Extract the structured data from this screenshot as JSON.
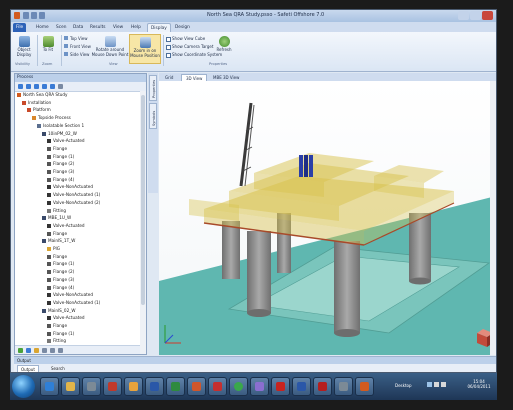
{
  "window": {
    "title": "North Sea QRA Study.psso - Safeti Offshore 7.0"
  },
  "ribbon_tabs": [
    "File",
    "Home",
    "Scen",
    "Data",
    "Results",
    "View",
    "Help",
    "Display",
    "Design"
  ],
  "ribbon": {
    "buttons": {
      "object_display": "Object Display",
      "to_fit": "To Fit",
      "top_view": "Top View",
      "front_view": "Front View",
      "side_view": "Side View",
      "rotate": "Rotate around Mouse Down Point",
      "zoom": "Zoom in on Mouse Position",
      "refresh": "Refresh"
    },
    "checkboxes": [
      "Show View Cube",
      "Show Camera Target",
      "Show Coordinate System"
    ],
    "groups": {
      "visibility": "Visibility",
      "zoom": "Zoom",
      "view": "View",
      "properties": "Properties"
    }
  },
  "process_panel": {
    "title": "Process",
    "tree": [
      {
        "label": "North Sea QRA Study",
        "indent": 0,
        "icon": "study"
      },
      {
        "label": "Installation",
        "indent": 1,
        "icon": "installation"
      },
      {
        "label": "Platform",
        "indent": 2,
        "icon": "platform"
      },
      {
        "label": "Topside Process",
        "indent": 3,
        "icon": "process"
      },
      {
        "label": "Isolatable Section 1",
        "indent": 4,
        "icon": "section"
      },
      {
        "label": "10inPM_02_W",
        "indent": 5,
        "icon": "pipe"
      },
      {
        "label": "Valve-Actuated",
        "indent": 6,
        "icon": "valve"
      },
      {
        "label": "Flange",
        "indent": 6,
        "icon": "flange"
      },
      {
        "label": "Flange (1)",
        "indent": 6,
        "icon": "flange"
      },
      {
        "label": "Flange (2)",
        "indent": 6,
        "icon": "flange"
      },
      {
        "label": "Flange (3)",
        "indent": 6,
        "icon": "flange"
      },
      {
        "label": "Flange (4)",
        "indent": 6,
        "icon": "flange"
      },
      {
        "label": "Valve-NonActuated",
        "indent": 6,
        "icon": "valve"
      },
      {
        "label": "Valve-NonActuated (1)",
        "indent": 6,
        "icon": "valve"
      },
      {
        "label": "Valve-NonActuated (2)",
        "indent": 6,
        "icon": "valve"
      },
      {
        "label": "Fitting",
        "indent": 6,
        "icon": "fitting"
      },
      {
        "label": "MBE_1U_W",
        "indent": 5,
        "icon": "pipe"
      },
      {
        "label": "Valve-Actuated",
        "indent": 6,
        "icon": "valve"
      },
      {
        "label": "Flange",
        "indent": 6,
        "icon": "flange"
      },
      {
        "label": "MainlS_1T_W",
        "indent": 5,
        "icon": "pipe"
      },
      {
        "label": "PIG",
        "indent": 6,
        "icon": "pig"
      },
      {
        "label": "Flange",
        "indent": 6,
        "icon": "flange"
      },
      {
        "label": "Flange (1)",
        "indent": 6,
        "icon": "flange"
      },
      {
        "label": "Flange (2)",
        "indent": 6,
        "icon": "flange"
      },
      {
        "label": "Flange (3)",
        "indent": 6,
        "icon": "flange"
      },
      {
        "label": "Flange (4)",
        "indent": 6,
        "icon": "flange"
      },
      {
        "label": "Valve-NonActuated",
        "indent": 6,
        "icon": "valve"
      },
      {
        "label": "Valve-NonActuated (1)",
        "indent": 6,
        "icon": "valve"
      },
      {
        "label": "MainlS_02_W",
        "indent": 5,
        "icon": "pipe"
      },
      {
        "label": "Valve-Actuated",
        "indent": 6,
        "icon": "valve"
      },
      {
        "label": "Flange",
        "indent": 6,
        "icon": "flange"
      },
      {
        "label": "Flange (1)",
        "indent": 6,
        "icon": "flange"
      },
      {
        "label": "Fitting",
        "indent": 6,
        "icon": "fitting"
      }
    ]
  },
  "side_tabs": [
    "Properties",
    "Symbols"
  ],
  "doc_tabs": [
    "Grid",
    "3D View",
    "MBE 3D View"
  ],
  "active_doc_tab": "3D View",
  "output_panel": {
    "title": "Output",
    "tabs": [
      "Output",
      "Search"
    ]
  },
  "taskbar": {
    "desktop_label": "Desktop",
    "time": "15:04",
    "date": "06/04/2011"
  },
  "colors": {
    "sea": "#5fb7b0",
    "deck": "#d8c24e",
    "legs": "#8c8c8c",
    "accent": "#2d62b8"
  }
}
